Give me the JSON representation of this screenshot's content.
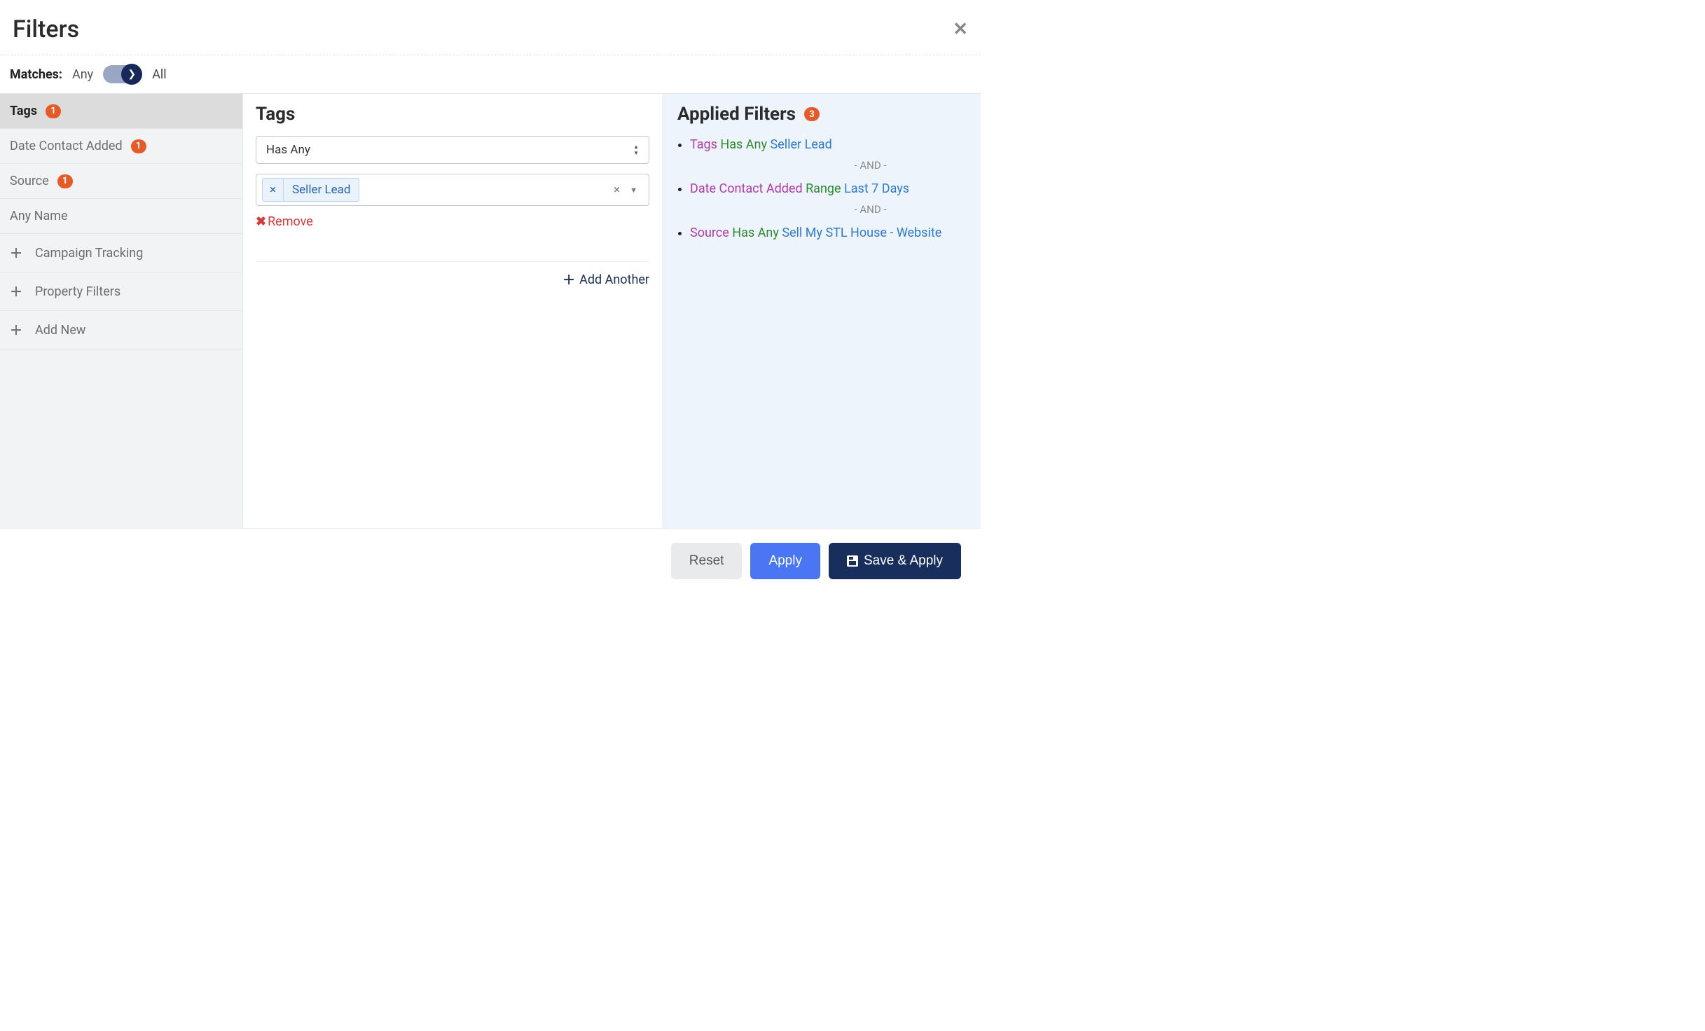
{
  "modal": {
    "title": "Filters"
  },
  "matches": {
    "label": "Matches:",
    "any": "Any",
    "all": "All"
  },
  "sidebar": {
    "items": [
      {
        "label": "Tags",
        "badge": "1",
        "active": true
      },
      {
        "label": "Date Contact Added",
        "badge": "1"
      },
      {
        "label": "Source",
        "badge": "1"
      },
      {
        "label": "Any Name"
      },
      {
        "label": "Campaign Tracking",
        "prefix_plus": true
      },
      {
        "label": "Property Filters",
        "prefix_plus": true
      },
      {
        "label": "Add New",
        "prefix_plus": true
      }
    ]
  },
  "center": {
    "heading": "Tags",
    "condition_select": "Has Any",
    "selected_tags": [
      {
        "label": "Seller Lead"
      }
    ],
    "remove_label": "Remove",
    "add_another_label": "Add Another"
  },
  "applied": {
    "heading": "Applied Filters",
    "badge": "3",
    "separator": "- AND -",
    "items": [
      {
        "field": "Tags",
        "op": "Has Any",
        "value": "Seller Lead"
      },
      {
        "field": "Date Contact Added",
        "op": "Range",
        "value": "Last 7 Days"
      },
      {
        "field": "Source",
        "op": "Has Any",
        "value": "Sell My STL House - Website"
      }
    ]
  },
  "footer": {
    "reset": "Reset",
    "apply": "Apply",
    "save_apply": "Save & Apply"
  }
}
